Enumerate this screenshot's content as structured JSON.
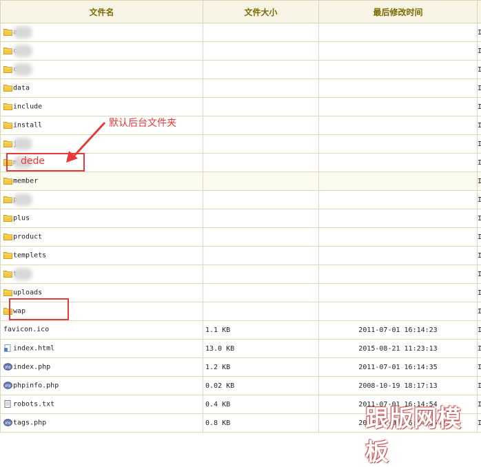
{
  "columns": {
    "name": "文件名",
    "size": "文件大小",
    "date": "最后修改时间"
  },
  "rows": [
    {
      "name": "a",
      "type": "folder",
      "blurred": true,
      "size": "",
      "date": ""
    },
    {
      "name": "c",
      "type": "folder",
      "blurred": true,
      "size": "",
      "date": ""
    },
    {
      "name": "c",
      "type": "folder",
      "blurred": true,
      "size": "",
      "date": ""
    },
    {
      "name": "data",
      "type": "folder",
      "size": "",
      "date": ""
    },
    {
      "name": "include",
      "type": "folder",
      "size": "",
      "date": ""
    },
    {
      "name": "install",
      "type": "folder",
      "size": "",
      "date": ""
    },
    {
      "name": "j",
      "type": "folder",
      "blurred": true,
      "size": "",
      "date": ""
    },
    {
      "name": "m",
      "type": "folder",
      "blurred": true,
      "size": "",
      "date": ""
    },
    {
      "name": "member",
      "type": "folder",
      "size": "",
      "date": "",
      "highlighted": true
    },
    {
      "name": "p",
      "type": "folder",
      "blurred": true,
      "size": "",
      "date": ""
    },
    {
      "name": "plus",
      "type": "folder",
      "size": "",
      "date": ""
    },
    {
      "name": "product",
      "type": "folder",
      "size": "",
      "date": ""
    },
    {
      "name": "templets",
      "type": "folder",
      "size": "",
      "date": ""
    },
    {
      "name": "t",
      "type": "folder",
      "blurred": true,
      "size": "",
      "date": ""
    },
    {
      "name": "uploads",
      "type": "folder",
      "size": "",
      "date": ""
    },
    {
      "name": "wap",
      "type": "folder",
      "size": "",
      "date": ""
    },
    {
      "name": "favicon.ico",
      "type": "ico",
      "size": "1.1 KB",
      "date": "2011-07-01 16:14:23"
    },
    {
      "name": "index.html",
      "type": "html",
      "size": "13.0 KB",
      "date": "2015-08-21 11:23:13"
    },
    {
      "name": "index.php",
      "type": "php",
      "size": "1.2 KB",
      "date": "2011-07-01 16:14:35"
    },
    {
      "name": "phpinfo.php",
      "type": "php",
      "size": "0.02 KB",
      "date": "2008-10-19 18:17:13"
    },
    {
      "name": "robots.txt",
      "type": "txt",
      "size": "0.4 KB",
      "date": "2011-07-01 16:14:54"
    },
    {
      "name": "tags.php",
      "type": "php",
      "size": "0.8 KB",
      "date": "2011-07-01 16:14:55"
    }
  ],
  "edge_glyph": "I",
  "annotation": {
    "label": "默认后台文件夹",
    "box_text": "dede"
  },
  "watermark": "跟版网模板",
  "colors": {
    "header_bg": "#f7f4e6",
    "header_text": "#7a6a00",
    "annotation": "#e73838",
    "highlight_row": "#fbfbef",
    "folder": "#f5c842"
  }
}
